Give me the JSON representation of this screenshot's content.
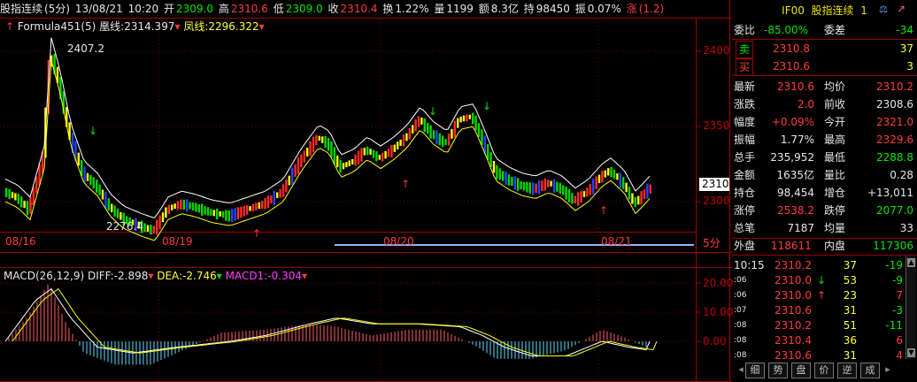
{
  "header": {
    "title": "股指连续",
    "period": "(5分)",
    "date": "13/08/21",
    "time": "10:20",
    "open_label": "开",
    "open": "2309.0",
    "high_label": "高",
    "high": "2310.6",
    "low_label": "低",
    "low": "2309.0",
    "close_label": "收",
    "close": "2310.4",
    "turnover_label": "换",
    "turnover": "1.22%",
    "volume_label": "量",
    "volume": "1199",
    "amount_label": "额",
    "amount": "8.3亿",
    "position_label": "持",
    "position": "98450",
    "amplitude_label": "振",
    "amplitude": "0.07%",
    "change_label": "涨",
    "change": "(1.2)"
  },
  "main_legend": {
    "formula": "Formula451(5)",
    "line1_label": "凰线:",
    "line1_value": "2314.397",
    "line2_label": "凤线:",
    "line2_value": "2296.322"
  },
  "main_axis": {
    "ticks": [
      "2400",
      "2350",
      "2300"
    ],
    "current_price_tag": "2310",
    "peak_label": "2407.2",
    "trough_label": "2276.4",
    "period_tag": "5分",
    "x_labels": [
      "08/16",
      "08/19",
      "08/20",
      "08/21"
    ]
  },
  "macd": {
    "name": "MACD(26,12,9)",
    "diff_label": "DIFF:",
    "diff_value": "-2.898",
    "dea_label": "DEA:",
    "dea_value": "-2.746",
    "macd_label": "MACD1:",
    "macd_value": "-0.304",
    "ticks": [
      "20.00",
      "10.00",
      "0.00"
    ]
  },
  "quote_panel": {
    "code": "IF00",
    "name": "股指连续",
    "index": "1",
    "ratio_label": "委比",
    "ratio": "-85.00%",
    "diff_label": "委差",
    "diff": "-34",
    "sell_label": "卖",
    "sell_price": "2310.8",
    "sell_vol": "37",
    "buy_label": "买",
    "buy_price": "2310.6",
    "buy_vol": "3",
    "stats": [
      {
        "l1": "最新",
        "v1": "2310.6",
        "l2": "均价",
        "v2": "2310.2",
        "c1": "r",
        "c2": "r"
      },
      {
        "l1": "涨跌",
        "v1": "2.0",
        "l2": "前收",
        "v2": "2308.6",
        "c1": "r",
        "c2": "w"
      },
      {
        "l1": "幅度",
        "v1": "+0.09%",
        "l2": "今开",
        "v2": "2321.0",
        "c1": "r",
        "c2": "r"
      },
      {
        "l1": "振幅",
        "v1": "1.77%",
        "l2": "最高",
        "v2": "2329.6",
        "c1": "w",
        "c2": "r"
      },
      {
        "l1": "总手",
        "v1": "235,952",
        "l2": "最低",
        "v2": "2288.8",
        "c1": "w",
        "c2": "g"
      },
      {
        "l1": "金额",
        "v1": "1635亿",
        "l2": "量比",
        "v2": "0.28",
        "c1": "w",
        "c2": "w"
      },
      {
        "l1": "持仓",
        "v1": "98,454",
        "l2": "增仓",
        "v2": "+13,011",
        "c1": "w",
        "c2": "w"
      },
      {
        "l1": "涨停",
        "v1": "2538.2",
        "l2": "跌停",
        "v2": "2077.0",
        "c1": "r",
        "c2": "g"
      },
      {
        "l1": "总笔",
        "v1": "7187",
        "l2": "均量",
        "v2": "33",
        "c1": "w",
        "c2": "w"
      }
    ],
    "outer_label": "外盘",
    "outer": "118611",
    "inner_label": "内盘",
    "inner": "117306",
    "trades": [
      {
        "t": "10:15",
        "p": "2310.2",
        "arrow": "",
        "v": "37",
        "d": "-19"
      },
      {
        "t": ":06",
        "p": "2310.0",
        "arrow": "↓",
        "v": "53",
        "d": "-9"
      },
      {
        "t": ":06",
        "p": "2310.0",
        "arrow": "↑",
        "v": "23",
        "d": "7"
      },
      {
        "t": ":07",
        "p": "2310.6",
        "arrow": "",
        "v": "31",
        "d": "-3"
      },
      {
        "t": ":08",
        "p": "2310.2",
        "arrow": "",
        "v": "51",
        "d": "-11"
      },
      {
        "t": ":08",
        "p": "2310.4",
        "arrow": "",
        "v": "36",
        "d": "6"
      },
      {
        "t": ":08",
        "p": "2310.6",
        "arrow": "",
        "v": "31",
        "d": "4"
      }
    ],
    "tabs": [
      "细",
      "势",
      "盘",
      "价",
      "逆",
      "成"
    ]
  },
  "colors": {
    "up": "#ff3333",
    "down": "#00e000",
    "neutral": "#3355ff",
    "accent": "#ffff00",
    "border": "#a00000"
  }
}
